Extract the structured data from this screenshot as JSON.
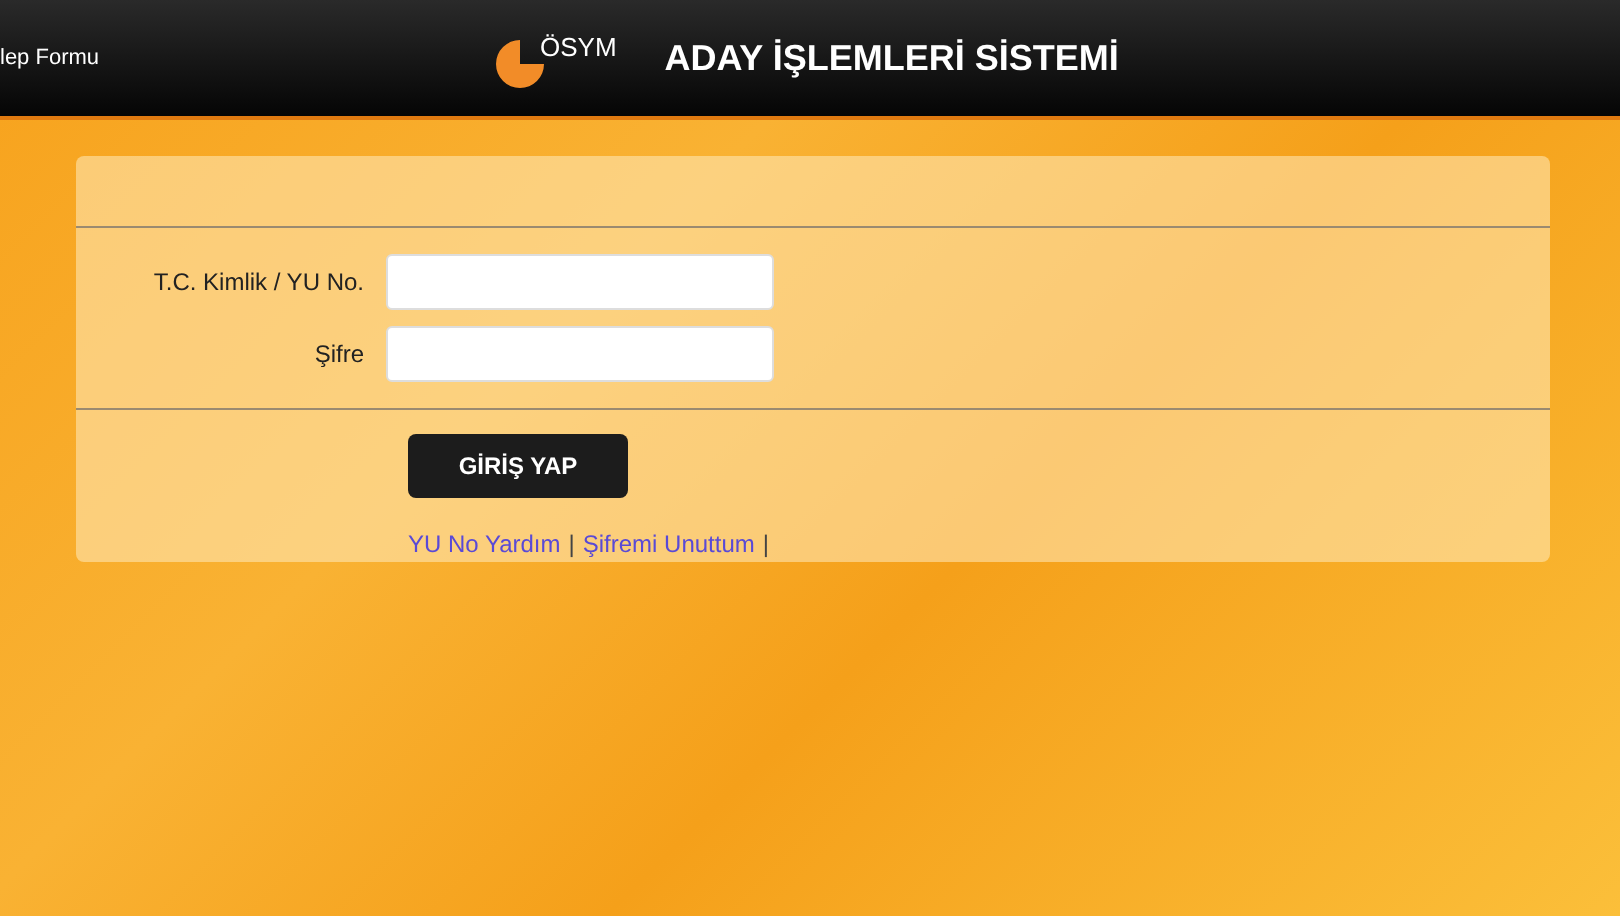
{
  "header": {
    "left_link": "lep Formu",
    "logo_text": "ÖSYM",
    "title": "ADAY İŞLEMLERİ SİSTEMİ"
  },
  "form": {
    "fields": [
      {
        "label": "T.C. Kimlik / YU No."
      },
      {
        "label": "Şifre"
      }
    ],
    "submit": "GİRİŞ YAP",
    "links": [
      {
        "text": "YU No Yardım",
        "kind": "link"
      },
      {
        "text": "|",
        "kind": "separator"
      },
      {
        "text": "Şifremi Unuttum",
        "kind": "link"
      },
      {
        "text": "|",
        "kind": "separator"
      }
    ]
  }
}
